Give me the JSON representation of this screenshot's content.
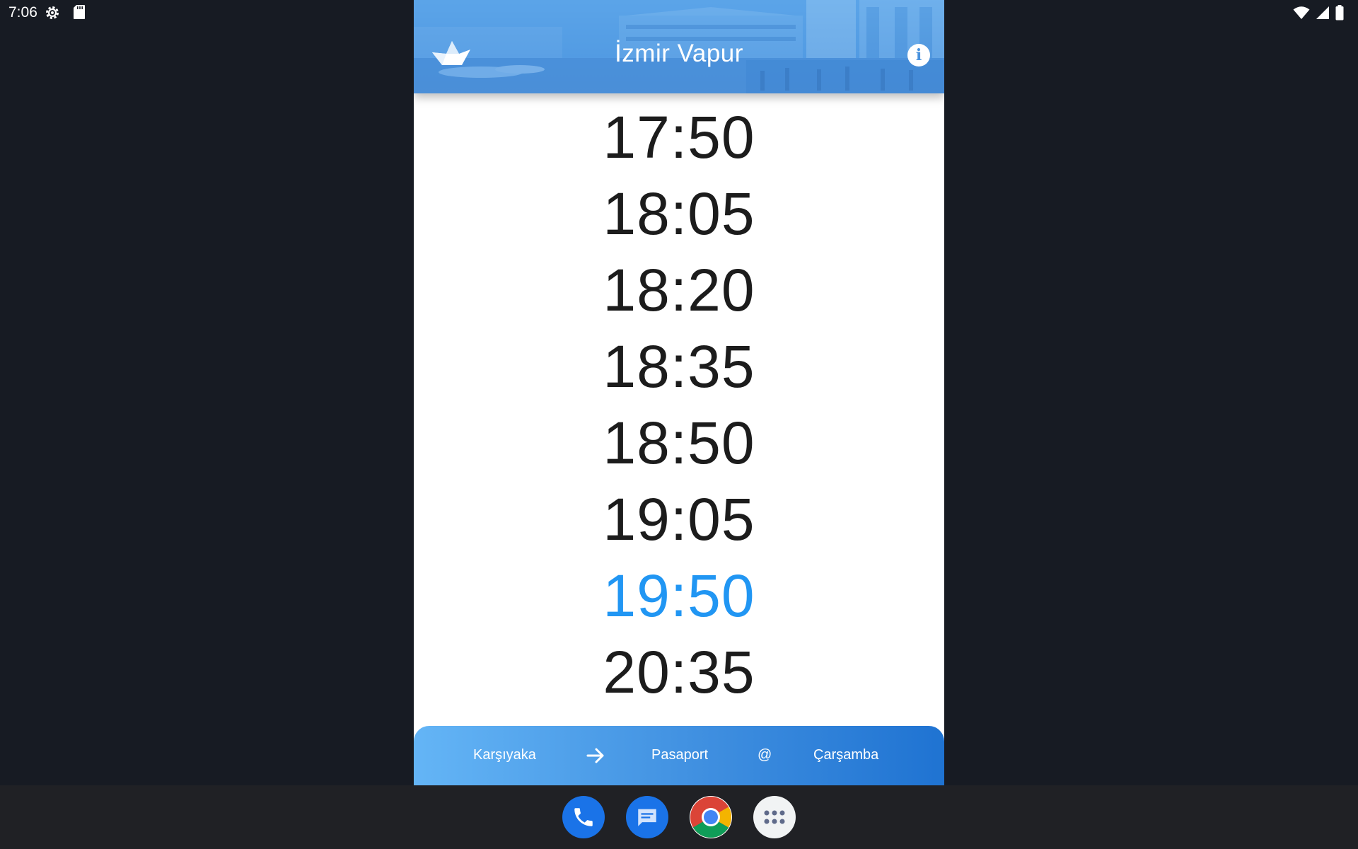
{
  "status_bar": {
    "time": "7:06",
    "icons": [
      "settings-gear-icon",
      "sd-card-icon",
      "wifi-icon",
      "cell-signal-icon",
      "battery-icon"
    ]
  },
  "header": {
    "title": "İzmir Vapur",
    "logo_icon": "paper-boat-icon",
    "info_icon": "info-icon",
    "info_glyph": "i",
    "bg_color": "#4a93de"
  },
  "times": [
    {
      "time": "17:50",
      "next": false
    },
    {
      "time": "18:05",
      "next": false
    },
    {
      "time": "18:20",
      "next": false
    },
    {
      "time": "18:35",
      "next": false
    },
    {
      "time": "18:50",
      "next": false
    },
    {
      "time": "19:05",
      "next": false
    },
    {
      "time": "19:50",
      "next": true
    },
    {
      "time": "20:35",
      "next": false
    }
  ],
  "bottom_bar": {
    "from": "Karşıyaka",
    "arrow_icon": "arrow-right-icon",
    "to": "Pasaport",
    "at": "@",
    "day": "Çarşamba"
  },
  "taskbar": {
    "apps": [
      "phone-app-icon",
      "messages-app-icon",
      "chrome-app-icon",
      "app-drawer-icon"
    ]
  },
  "colors": {
    "accent": "#2196f3",
    "time_text": "#1c1c1c",
    "background": "#171b23"
  }
}
